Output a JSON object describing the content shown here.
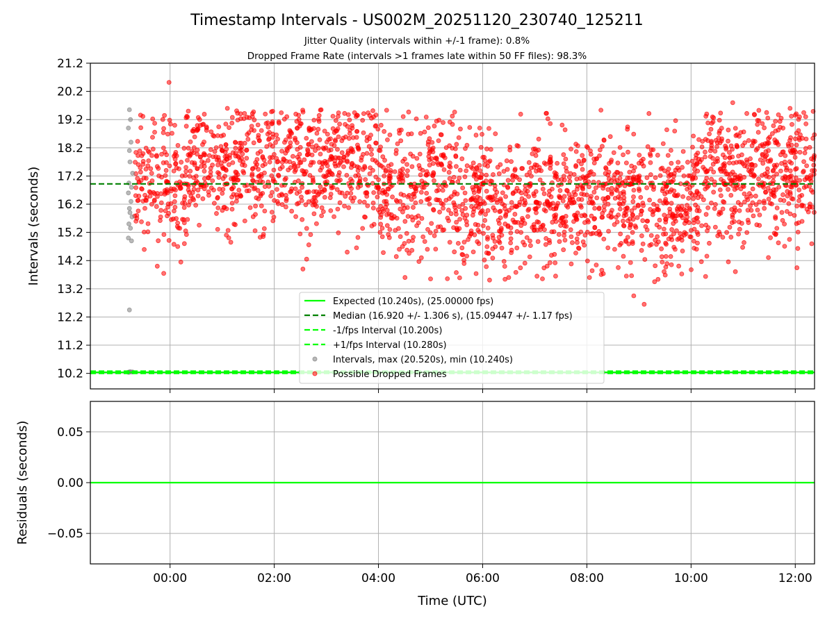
{
  "chart_data": [
    {
      "type": "scatter",
      "title": "Timestamp Intervals - US002M_20251120_230740_125211",
      "subtitles": [
        "Jitter Quality (intervals within +/-1 frame): 0.8%",
        "Dropped Frame Rate (intervals >1 frames late within 50 FF files): 98.3%"
      ],
      "xlabel": "",
      "ylabel": "Intervals (seconds)",
      "x_ticks": [
        "00:00",
        "02:00",
        "04:00",
        "06:00",
        "08:00",
        "10:00",
        "12:00"
      ],
      "y_ticks": [
        "10.2",
        "11.2",
        "12.2",
        "13.2",
        "14.2",
        "15.2",
        "16.2",
        "17.2",
        "18.2",
        "19.2",
        "20.2",
        "21.2"
      ],
      "xlim_hours": [
        -1.53,
        12.37
      ],
      "ylim": [
        9.65,
        21.2
      ],
      "grid": true,
      "legend_position": "lower center",
      "lines": [
        {
          "name": "Expected (10.240s), (25.00000 fps)",
          "y": 10.24,
          "style": "solid",
          "color": "#00ff00"
        },
        {
          "name": "Median (16.920 +/- 1.306 s), (15.09447 +/- 1.17 fps)",
          "y": 16.92,
          "style": "dashed",
          "color": "#008000"
        },
        {
          "name": "-1/fps Interval (10.200s)",
          "y": 10.2,
          "style": "dashed",
          "color": "#00ff00"
        },
        {
          "name": "+1/fps Interval (10.280s)",
          "y": 10.28,
          "style": "dashed",
          "color": "#00ff00"
        }
      ],
      "series": [
        {
          "name": "Intervals, max (20.520s), min (10.240s)",
          "color": "#808080",
          "x": [
            -0.78,
            -0.76,
            -0.8,
            -0.75,
            -0.78,
            -0.77,
            -0.72,
            -0.79,
            -0.74,
            -0.8,
            -0.75,
            -0.78,
            -0.77,
            -0.73,
            -0.79,
            -0.76,
            -0.8,
            -0.74,
            -0.78,
            -0.72,
            -0.8,
            -0.77,
            -0.79,
            -0.75
          ],
          "y": [
            19.55,
            19.2,
            18.9,
            18.4,
            18.1,
            17.7,
            17.3,
            16.95,
            16.8,
            16.6,
            16.3,
            16.05,
            15.9,
            15.75,
            15.5,
            15.35,
            15.0,
            14.9,
            12.45,
            10.25,
            10.24,
            10.26,
            10.24,
            10.25
          ]
        },
        {
          "name": "Possible Dropped Frames",
          "color": "#ff0000",
          "x": [
            -0.02,
            0.35,
            1.1,
            2.9,
            4.05,
            5.0,
            6.5,
            7.4,
            8.05,
            8.9,
            9.1,
            9.3,
            10.3,
            10.8,
            11.45,
            11.9,
            12.2,
            2.55,
            3.4,
            4.4
          ],
          "y": [
            20.52,
            19.5,
            19.6,
            19.55,
            19.0,
            13.55,
            13.6,
            13.65,
            13.6,
            12.95,
            12.65,
            13.45,
            19.4,
            19.8,
            19.45,
            19.6,
            19.3,
            13.9,
            14.5,
            14.6
          ]
        }
      ]
    },
    {
      "type": "line",
      "title": "",
      "xlabel": "Time (UTC)",
      "ylabel": "Residuals (seconds)",
      "x_ticks": [
        "00:00",
        "02:00",
        "04:00",
        "06:00",
        "08:00",
        "10:00",
        "12:00"
      ],
      "y_ticks": [
        "0.05",
        "0.00",
        "−0.05"
      ],
      "ylim": [
        -0.08,
        0.08
      ],
      "grid": true,
      "series": [
        {
          "name": "",
          "color": "#00ff00",
          "x": [
            -1.53,
            12.37
          ],
          "y": [
            0.0,
            0.0
          ]
        }
      ]
    }
  ],
  "colors": {
    "expected": "#00ff00",
    "median": "#008000",
    "dropped": "#ff0000",
    "intervals": "#808080",
    "grid": "#b0b0b0"
  }
}
